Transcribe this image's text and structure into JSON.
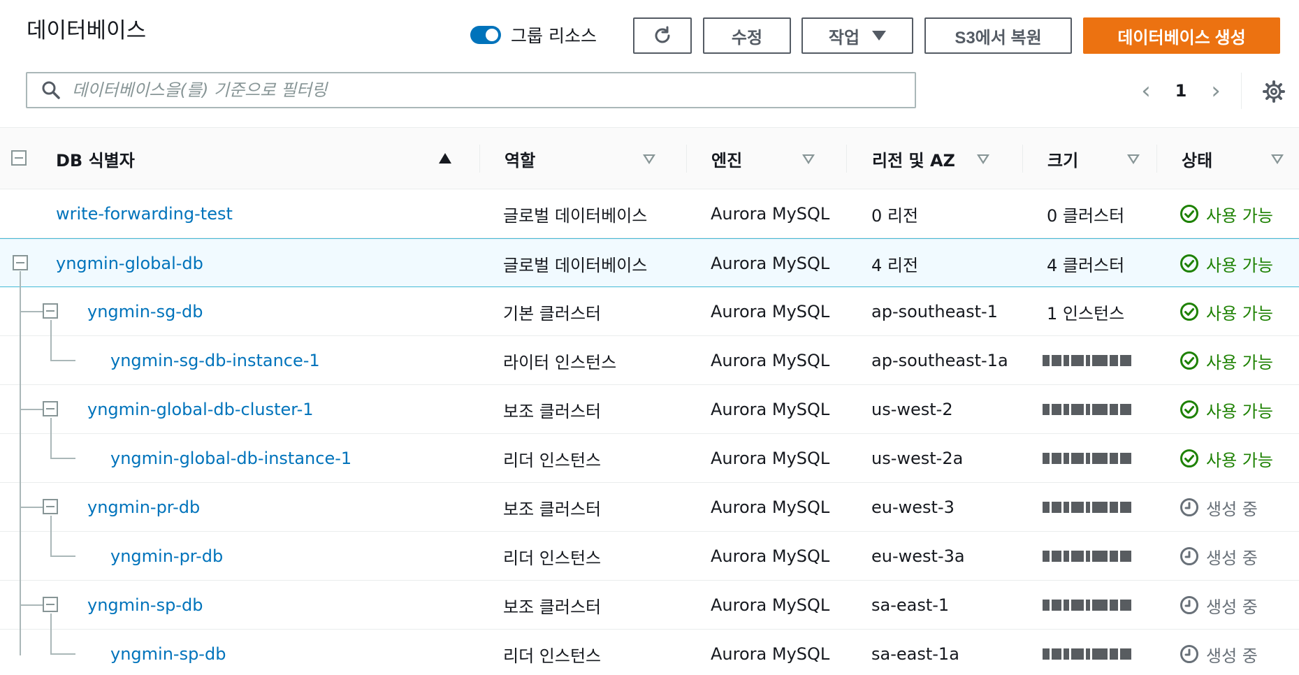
{
  "header": {
    "title": "데이터베이스",
    "group_toggle_label": "그룹 리소스",
    "edit_label": "수정",
    "actions_label": "작업",
    "restore_label": "S3에서 복원",
    "create_label": "데이터베이스 생성"
  },
  "search": {
    "placeholder": "데이터베이스을(를) 기준으로 필터링",
    "value": ""
  },
  "pager": {
    "page": "1"
  },
  "colors": {
    "primary": "#ec7211",
    "link": "#0073bb",
    "available": "#1d8102",
    "pending": "#687078"
  },
  "table": {
    "columns": [
      "DB 식별자",
      "역할",
      "엔진",
      "리전 및 AZ",
      "크기",
      "상태"
    ],
    "rows": [
      {
        "id": "write-forwarding-test",
        "role": "글로벌 데이터베이스",
        "engine": "Aurora MySQL",
        "region": "0 리전",
        "size": "0 클러스터",
        "status": "사용 가능",
        "status_type": "available"
      },
      {
        "id": "yngmin-global-db",
        "role": "글로벌 데이터베이스",
        "engine": "Aurora MySQL",
        "region": "4 리전",
        "size": "4 클러스터",
        "status": "사용 가능",
        "status_type": "available"
      },
      {
        "id": "yngmin-sg-db",
        "role": "기본 클러스터",
        "engine": "Aurora MySQL",
        "region": "ap-southeast-1",
        "size": "1 인스턴스",
        "status": "사용 가능",
        "status_type": "available"
      },
      {
        "id": "yngmin-sg-db-instance-1",
        "role": "라이터 인스턴스",
        "engine": "Aurora MySQL",
        "region": "ap-southeast-1a",
        "size": "",
        "status": "사용 가능",
        "status_type": "available"
      },
      {
        "id": "yngmin-global-db-cluster-1",
        "role": "보조 클러스터",
        "engine": "Aurora MySQL",
        "region": "us-west-2",
        "size": "",
        "status": "사용 가능",
        "status_type": "available"
      },
      {
        "id": "yngmin-global-db-instance-1",
        "role": "리더 인스턴스",
        "engine": "Aurora MySQL",
        "region": "us-west-2a",
        "size": "",
        "status": "사용 가능",
        "status_type": "available"
      },
      {
        "id": "yngmin-pr-db",
        "role": "보조 클러스터",
        "engine": "Aurora MySQL",
        "region": "eu-west-3",
        "size": "",
        "status": "생성 중",
        "status_type": "pending"
      },
      {
        "id": "yngmin-pr-db",
        "role": "리더 인스턴스",
        "engine": "Aurora MySQL",
        "region": "eu-west-3a",
        "size": "",
        "status": "생성 중",
        "status_type": "pending"
      },
      {
        "id": "yngmin-sp-db",
        "role": "보조 클러스터",
        "engine": "Aurora MySQL",
        "region": "sa-east-1",
        "size": "",
        "status": "생성 중",
        "status_type": "pending"
      },
      {
        "id": "yngmin-sp-db",
        "role": "리더 인스턴스",
        "engine": "Aurora MySQL",
        "region": "sa-east-1a",
        "size": "",
        "status": "생성 중",
        "status_type": "pending"
      }
    ]
  }
}
